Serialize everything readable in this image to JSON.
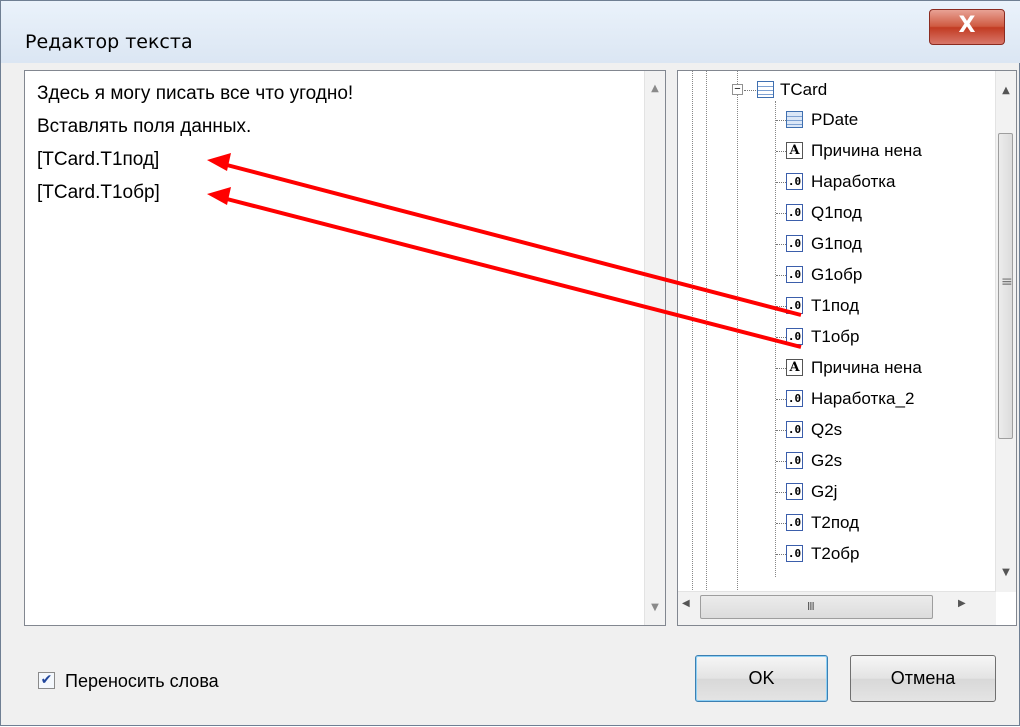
{
  "window": {
    "title": "Редактор текста",
    "close_label": "X"
  },
  "editor": {
    "lines": [
      "Здесь я могу писать все что угодно!",
      "Вставлять поля данных.",
      "[TCard.T1под]",
      "[TCard.T1обр]"
    ],
    "scroll_up": "▲",
    "scroll_down": "▼"
  },
  "tree": {
    "root": {
      "label": "TCard",
      "icon": "table-icon",
      "expander": "−"
    },
    "items": [
      {
        "label": "PDate",
        "icon": "date-field-icon"
      },
      {
        "label": "Причина нена",
        "icon": "string-field-icon"
      },
      {
        "label": "Наработка",
        "icon": "number-field-icon"
      },
      {
        "label": "Q1под",
        "icon": "number-field-icon"
      },
      {
        "label": "G1под",
        "icon": "number-field-icon"
      },
      {
        "label": "G1обр",
        "icon": "number-field-icon"
      },
      {
        "label": "T1под",
        "icon": "number-field-icon"
      },
      {
        "label": "T1обр",
        "icon": "number-field-icon"
      },
      {
        "label": "Причина нена",
        "icon": "string-field-icon"
      },
      {
        "label": "Наработка_2",
        "icon": "number-field-icon"
      },
      {
        "label": "Q2s",
        "icon": "number-field-icon"
      },
      {
        "label": "G2s",
        "icon": "number-field-icon"
      },
      {
        "label": "G2j",
        "icon": "number-field-icon"
      },
      {
        "label": "T2под",
        "icon": "number-field-icon"
      },
      {
        "label": "T2обр",
        "icon": "number-field-icon"
      }
    ],
    "icon_text": {
      "number": ".0",
      "string": "A"
    },
    "scroll_up": "▲",
    "scroll_down": "▼",
    "scroll_left": "◀",
    "scroll_right": "▶",
    "hgrip": "III",
    "vgrip": "≡"
  },
  "options": {
    "wrap_words_label": "Переносить слова",
    "wrap_words_checked": true,
    "check_mark": "✔"
  },
  "buttons": {
    "ok": "OK",
    "cancel": "Отмена"
  },
  "colors": {
    "arrow": "#ff0000"
  }
}
